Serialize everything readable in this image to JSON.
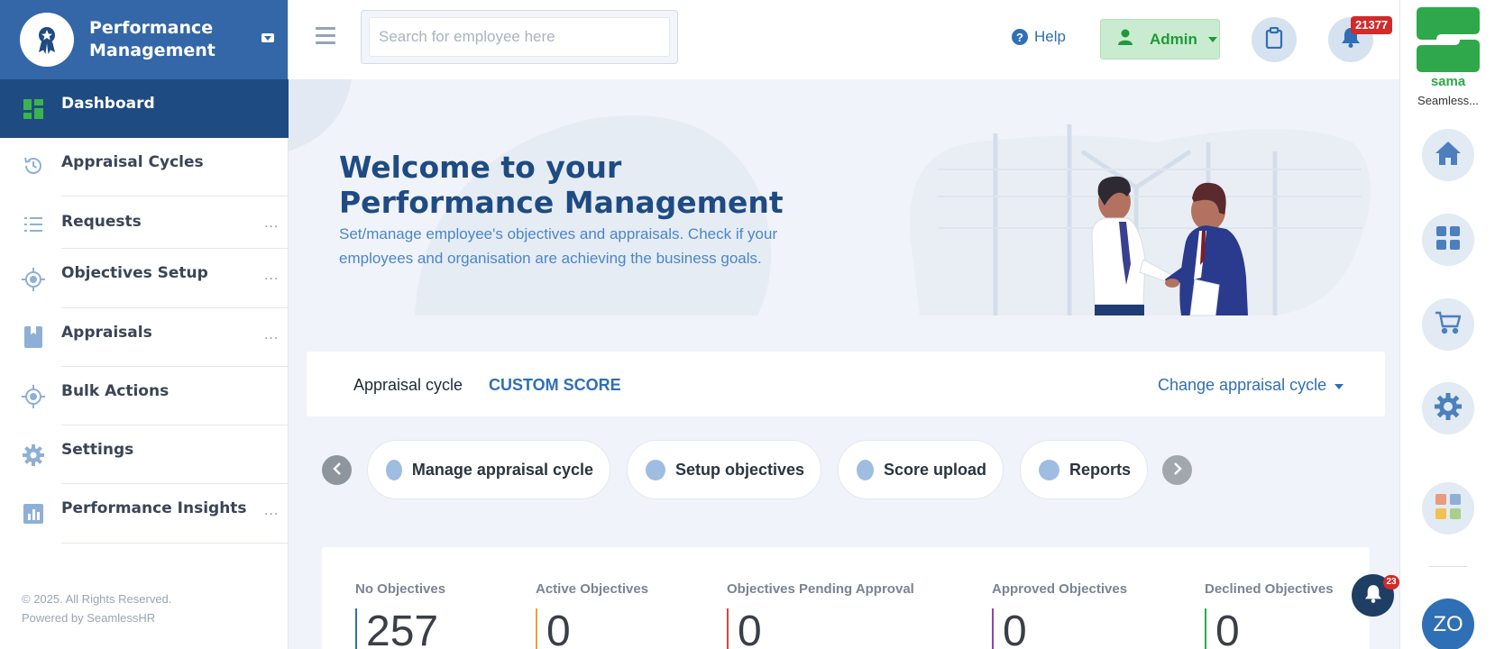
{
  "brand": {
    "title": "Performance Management"
  },
  "sidebar": {
    "items": [
      {
        "label": "Dashboard",
        "active": true,
        "icon": "dashboard-icon",
        "has_more": false
      },
      {
        "label": "Appraisal Cycles",
        "active": false,
        "icon": "history-icon",
        "has_more": false
      },
      {
        "label": "Requests",
        "active": false,
        "icon": "list-icon",
        "has_more": true
      },
      {
        "label": "Objectives Setup",
        "active": false,
        "icon": "target-icon",
        "has_more": true
      },
      {
        "label": "Appraisals",
        "active": false,
        "icon": "book-icon",
        "has_more": true
      },
      {
        "label": "Bulk Actions",
        "active": false,
        "icon": "target-icon",
        "has_more": false
      },
      {
        "label": "Settings",
        "active": false,
        "icon": "gear-icon",
        "has_more": false
      },
      {
        "label": "Performance Insights",
        "active": false,
        "icon": "chart-icon",
        "has_more": true
      }
    ],
    "more_label": "...",
    "footer_copyright": "© 2025. All Rights Reserved.",
    "footer_powered": "Powered by SeamlessHR"
  },
  "topbar": {
    "search_placeholder": "Search for employee here",
    "help_label": "Help",
    "admin_label": "Admin",
    "notification_count": "21377"
  },
  "rail": {
    "logo_text": "Seamless...",
    "avatar_initials": "ZO",
    "float_notification_count": "23"
  },
  "hero": {
    "title_line1": "Welcome to your",
    "title_line2": "Performance Management",
    "subtitle": "Set/manage employee's objectives and appraisals. Check if your employees and organisation are achieving the business goals."
  },
  "cycle": {
    "label": "Appraisal cycle",
    "value": "CUSTOM SCORE",
    "change_label": "Change appraisal cycle"
  },
  "quick_actions": [
    {
      "label": "Manage appraisal cycle"
    },
    {
      "label": "Setup objectives"
    },
    {
      "label": "Score upload"
    },
    {
      "label": "Reports"
    }
  ],
  "stats": [
    {
      "label": "No Objectives",
      "value": "257",
      "color": "#2f6fb5"
    },
    {
      "label": "Active Objectives",
      "value": "0",
      "color": "#e8a13c"
    },
    {
      "label": "Objectives Pending Approval",
      "value": "0",
      "color": "#d64545"
    },
    {
      "label": "Approved Objectives",
      "value": "0",
      "color": "#8e44ad"
    },
    {
      "label": "Declined Objectives",
      "value": "0",
      "color": "#2ea84a"
    }
  ],
  "colors": {
    "brand": "#3367a8",
    "active_nav": "#1f4b83",
    "accent": "#2f6fb5",
    "admin_green": "#1e9a3a",
    "badge_red": "#d12b2b"
  }
}
